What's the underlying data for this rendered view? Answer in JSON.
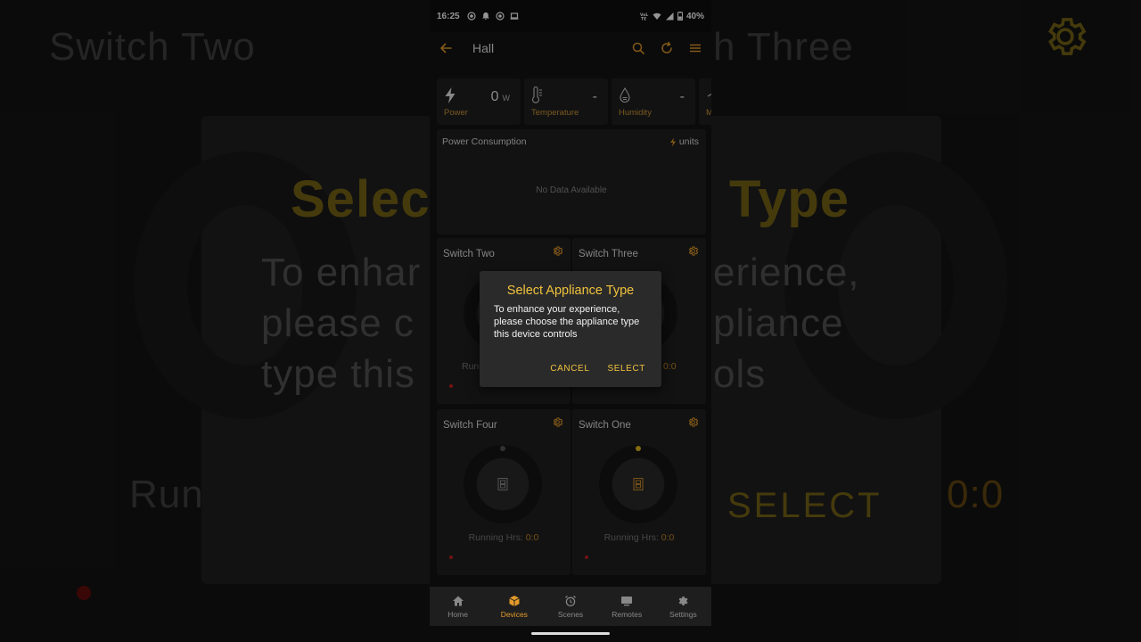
{
  "statusbar": {
    "time": "16:25",
    "battery": "40%"
  },
  "appbar": {
    "title": "Hall"
  },
  "sensors": [
    {
      "icon": "lightning-icon",
      "value": "0",
      "unit": "W",
      "label": "Power"
    },
    {
      "icon": "thermometer-icon",
      "value": "-",
      "unit": "",
      "label": "Temperature"
    },
    {
      "icon": "humidity-icon",
      "value": "-",
      "unit": "",
      "label": "Humidity"
    },
    {
      "icon": "motion-icon",
      "value": "",
      "unit": "",
      "label": "M"
    }
  ],
  "power": {
    "title": "Power Consumption",
    "units": "units",
    "empty": "No Data Available"
  },
  "cards": [
    {
      "title": "Switch Two",
      "running_label": "Runn",
      "running_value": ""
    },
    {
      "title": "Switch Three",
      "running_label": "",
      "running_value": "0:0"
    },
    {
      "title": "Switch Four",
      "running_label": "Running Hrs:",
      "running_value": "0:0",
      "dot_color": "#555555"
    },
    {
      "title": "Switch One",
      "running_label": "Running Hrs:",
      "running_value": "0:0",
      "dot_color": "#e0b91e"
    }
  ],
  "dialog": {
    "title": "Select Appliance Type",
    "message": "To enhance your experience, please choose the appliance type this device controls",
    "cancel": "CANCEL",
    "select": "SELECT"
  },
  "nav": [
    {
      "label": "Home",
      "icon": "home-icon",
      "active": false
    },
    {
      "label": "Devices",
      "icon": "box-icon",
      "active": true
    },
    {
      "label": "Scenes",
      "icon": "alarm-icon",
      "active": false
    },
    {
      "label": "Remotes",
      "icon": "tv-icon",
      "active": false
    },
    {
      "label": "Settings",
      "icon": "gear-icon",
      "active": false
    }
  ],
  "background": {
    "left_title": "Switch Two",
    "right_title": "h Three",
    "select_left": "Selec",
    "select_right": "Type",
    "msg_line1_left": "To enhar",
    "msg_line1_right": "erience,",
    "msg_line2_left": "please c",
    "msg_line2_right": "pliance",
    "msg_line3_left": "type this",
    "msg_line3_right": "ols",
    "running_left": "Run",
    "select_btn": "SELECT",
    "time_right": "0:0"
  },
  "colors": {
    "accent": "#e29a2a",
    "dialog_accent": "#f0c23c",
    "card_bg": "#202020",
    "screen_bg": "#141414"
  }
}
